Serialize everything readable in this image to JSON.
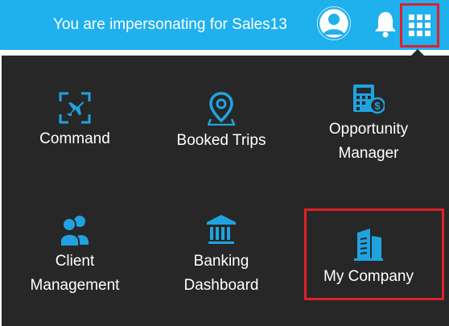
{
  "header": {
    "impersonation_text": "You are impersonating for Sales13",
    "avatar_icon": "user-avatar-icon",
    "bell_icon": "bell-icon",
    "apps_icon": "apps-grid-icon"
  },
  "colors": {
    "topbar": "#1fb0ee",
    "panel": "#272727",
    "accent_icon": "#1fa3e0",
    "highlight": "#e0202a"
  },
  "menu": {
    "items": [
      {
        "icon": "airplane-icon",
        "lines": [
          "Command"
        ]
      },
      {
        "icon": "map-pin-icon",
        "lines": [
          "Booked Trips"
        ]
      },
      {
        "icon": "calculator-dollar-icon",
        "lines": [
          "Opportunity",
          "Manager"
        ]
      },
      {
        "icon": "users-icon",
        "lines": [
          "Client",
          "Management"
        ]
      },
      {
        "icon": "bank-icon",
        "lines": [
          "Banking",
          "Dashboard"
        ]
      },
      {
        "icon": "building-icon",
        "lines": [
          "My Company"
        ]
      }
    ]
  }
}
